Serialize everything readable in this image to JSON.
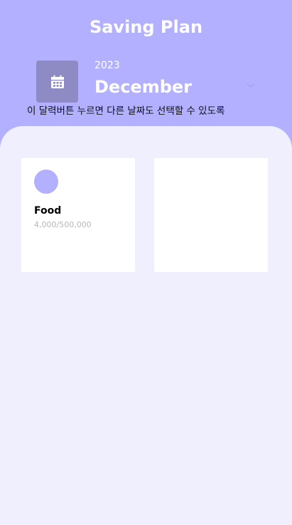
{
  "header": {
    "title": "Saving Plan",
    "year": "2023",
    "month": "December",
    "calendar_icon": "calendar-icon",
    "dropdown_icon": "chevron-down-icon",
    "note": "이 달력버튼 누르면 다른 날짜도 선택할 수 있도록"
  },
  "cards": [
    {
      "name": "Food",
      "amount": "4,000/500,000",
      "icon": "category-dot"
    }
  ],
  "colors": {
    "accent": "#b2b0ff",
    "calendar_button": "#8e8bc4",
    "background": "#f0effd",
    "card": "#ffffff",
    "muted_text": "#b7b7b7"
  }
}
